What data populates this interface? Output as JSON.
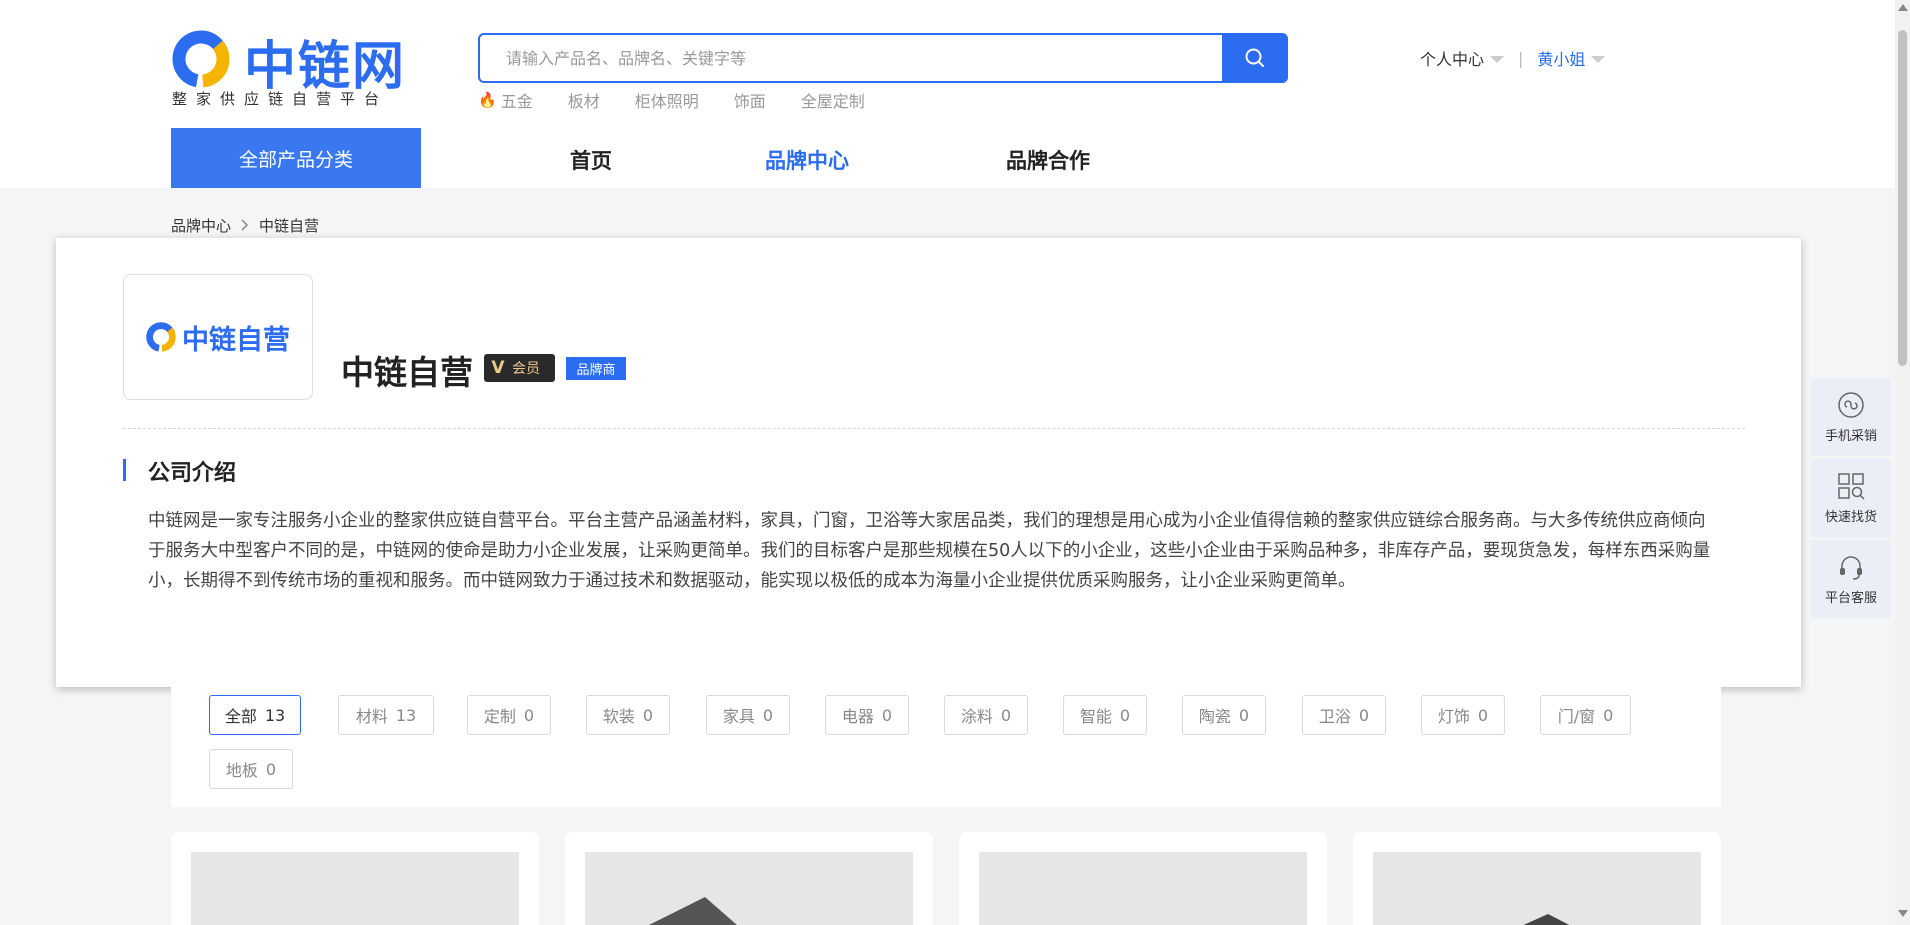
{
  "header": {
    "logo_text": "中链网",
    "logo_sub": "整家供应链自营平台",
    "search": {
      "placeholder": "请输入产品名、品牌名、关键字等"
    },
    "hot_tags": [
      "五金",
      "板材",
      "柜体照明",
      "饰面",
      "全屋定制"
    ],
    "user_center": "个人中心",
    "user_name": "黄小姐"
  },
  "nav": {
    "all_categories": "全部产品分类",
    "items": [
      "首页",
      "品牌中心",
      "品牌合作"
    ],
    "active": "品牌中心"
  },
  "breadcrumb": [
    "品牌中心",
    "中链自营"
  ],
  "brand": {
    "logo_text": "中链自营",
    "title": "中链自营",
    "member_badge": "会员",
    "member_v": "V",
    "brand_badge": "品牌商",
    "section_title": "公司介绍",
    "intro": "中链网是一家专注服务小企业的整家供应链自营平台。平台主营产品涵盖材料，家具，门窗，卫浴等大家居品类，我们的理想是用心成为小企业值得信赖的整家供应链综合服务商。与大多传统供应商倾向于服务大中型客户不同的是，中链网的使命是助力小企业发展，让采购更简单。我们的目标客户是那些规模在50人以下的小企业，这些小企业由于采购品种多，非库存产品，要现货急发，每样东西采购量小，长期得不到传统市场的重视和服务。而中链网致力于通过技术和数据驱动，能实现以极低的成本为海量小企业提供优质采购服务，让小企业采购更简单。"
  },
  "filters": [
    {
      "label": "全部",
      "count": "13",
      "active": true
    },
    {
      "label": "材料",
      "count": "13"
    },
    {
      "label": "定制",
      "count": "0"
    },
    {
      "label": "软装",
      "count": "0"
    },
    {
      "label": "家具",
      "count": "0"
    },
    {
      "label": "电器",
      "count": "0"
    },
    {
      "label": "涂料",
      "count": "0"
    },
    {
      "label": "智能",
      "count": "0"
    },
    {
      "label": "陶瓷",
      "count": "0"
    },
    {
      "label": "卫浴",
      "count": "0"
    },
    {
      "label": "灯饰",
      "count": "0"
    },
    {
      "label": "门/窗",
      "count": "0"
    },
    {
      "label": "地板",
      "count": "0"
    }
  ],
  "side_panel": [
    "手机采销",
    "快速找货",
    "平台客服"
  ],
  "colors": {
    "primary": "#2b6cf0",
    "logo_yellow": "#f5b400"
  }
}
